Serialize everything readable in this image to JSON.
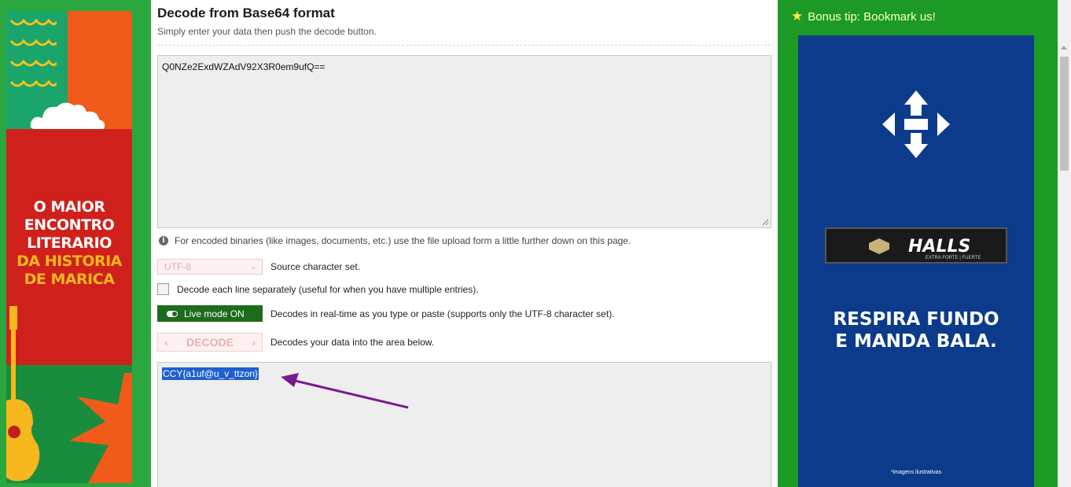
{
  "page": {
    "title": "Decode from Base64 format",
    "subtitle": "Simply enter your data then push the decode button."
  },
  "input": {
    "value": "Q0NZe2ExdWZAdV92X3R0em9ufQ=="
  },
  "info": {
    "icon": "info-icon",
    "text": "For encoded binaries (like images, documents, etc.) use the file upload form a little further down on this page."
  },
  "charset": {
    "selected": "UTF-8",
    "label": "Source character set."
  },
  "each_line": {
    "checked": false,
    "label": "Decode each line separately (useful for when you have multiple entries)."
  },
  "live_mode": {
    "button_label": "Live mode ON",
    "label": "Decodes in real-time as you type or paste (supports only the UTF-8 character set)."
  },
  "decode": {
    "button_label": "DECODE",
    "label": "Decodes your data into the area below."
  },
  "output": {
    "value": "CCY{a1uf@u_v_ttzon}",
    "arrow_color": "#7a1a8c"
  },
  "left_ad": {
    "line1": "O MAIOR",
    "line2": "ENCONTRO",
    "line3": "LITERARIO",
    "line4": "DA HISTORIA",
    "line5": "DE MARICA"
  },
  "right_panel": {
    "bonus_tip": "Bonus tip: Bookmark us!",
    "ad_brand": "HALLS",
    "ad_brand_sub": "EXTRA FORTE | FUERTE",
    "ad_line1": "RESPIRA FUNDO",
    "ad_line2": "E MANDA BALA.",
    "ad_footnote": "*imagens ilustrativas"
  },
  "colors": {
    "page_green": "#21a24a",
    "right_green": "#1c9a25",
    "live_button": "#1d6b1d",
    "selection": "#1f5fcf",
    "ad_blue": "#0c3b8c"
  }
}
